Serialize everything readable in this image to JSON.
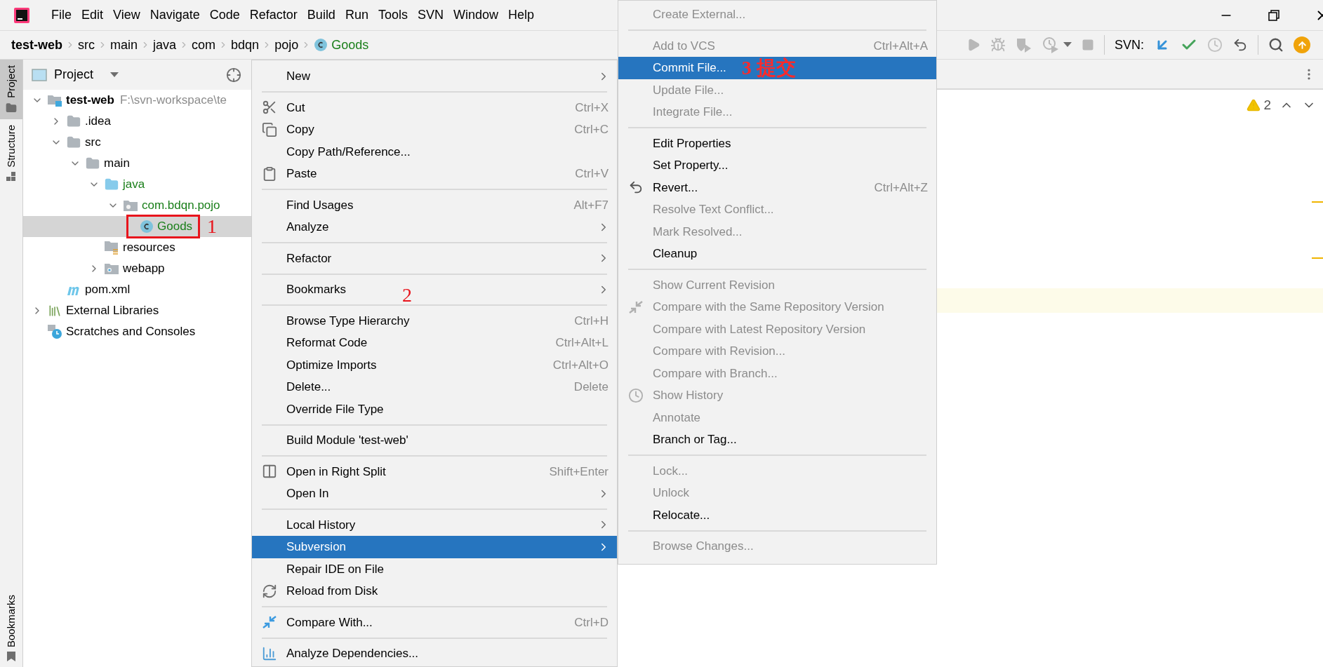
{
  "menu_bar": {
    "items": [
      "File",
      "Edit",
      "View",
      "Navigate",
      "Code",
      "Refactor",
      "Build",
      "Run",
      "Tools",
      "SVN",
      "Window",
      "Help"
    ]
  },
  "breadcrumbs": [
    {
      "label": "test-web",
      "kind": "project",
      "added": false
    },
    {
      "label": "src",
      "kind": "folder",
      "added": false
    },
    {
      "label": "main",
      "kind": "folder",
      "added": false
    },
    {
      "label": "java",
      "kind": "folder",
      "added": false
    },
    {
      "label": "com",
      "kind": "folder",
      "added": false
    },
    {
      "label": "bdqn",
      "kind": "folder",
      "added": false
    },
    {
      "label": "pojo",
      "kind": "folder",
      "added": false
    },
    {
      "label": "Goods",
      "kind": "class",
      "added": true
    }
  ],
  "toolbar": {
    "svn_label": "SVN:"
  },
  "tool_stripe": {
    "top": [
      {
        "label": "Project",
        "selected": true
      },
      {
        "label": "Structure",
        "selected": false
      }
    ],
    "bottom": [
      {
        "label": "Bookmarks",
        "selected": false
      }
    ]
  },
  "project_panel": {
    "title": "Project",
    "tree": [
      {
        "label": "test-web",
        "hint": "F:\\svn-workspace\\te",
        "kind": "module",
        "added": false,
        "selected": false,
        "expanded": true,
        "children": [
          {
            "label": ".idea",
            "kind": "folder",
            "added": false,
            "selected": false,
            "expanded": false
          },
          {
            "label": "src",
            "kind": "folder",
            "added": false,
            "selected": false,
            "expanded": true,
            "children": [
              {
                "label": "main",
                "kind": "folder",
                "added": false,
                "selected": false,
                "expanded": true,
                "children": [
                  {
                    "label": "java",
                    "kind": "source-folder",
                    "added": true,
                    "selected": false,
                    "expanded": true,
                    "children": [
                      {
                        "label": "com.bdqn.pojo",
                        "kind": "package",
                        "added": true,
                        "selected": false,
                        "expanded": true,
                        "children": [
                          {
                            "label": "Goods",
                            "kind": "class",
                            "added": true,
                            "selected": true,
                            "annotation": "1"
                          }
                        ]
                      }
                    ]
                  },
                  {
                    "label": "resources",
                    "kind": "resources-folder",
                    "added": false,
                    "selected": false
                  },
                  {
                    "label": "webapp",
                    "kind": "web-folder",
                    "added": false,
                    "selected": false,
                    "expanded": false
                  }
                ]
              }
            ]
          },
          {
            "label": "pom.xml",
            "kind": "maven-file",
            "added": false,
            "selected": false
          }
        ]
      },
      {
        "label": "External Libraries",
        "kind": "libraries",
        "added": false,
        "selected": false,
        "expanded": false
      },
      {
        "label": "Scratches and Consoles",
        "kind": "scratches",
        "added": false,
        "selected": false
      }
    ]
  },
  "context_menu": {
    "sections": [
      [
        {
          "label": "New",
          "submenu": true,
          "selected": false
        }
      ],
      [
        {
          "label": "Cut",
          "shortcut": "Ctrl+X",
          "submenu": false,
          "selected": false
        },
        {
          "label": "Copy",
          "shortcut": "Ctrl+C",
          "submenu": false,
          "selected": false
        },
        {
          "label": "Copy Path/Reference...",
          "submenu": false,
          "selected": false
        },
        {
          "label": "Paste",
          "shortcut": "Ctrl+V",
          "submenu": false,
          "selected": false
        }
      ],
      [
        {
          "label": "Find Usages",
          "shortcut": "Alt+F7",
          "submenu": false,
          "selected": false
        },
        {
          "label": "Analyze",
          "submenu": true,
          "selected": false
        }
      ],
      [
        {
          "label": "Refactor",
          "submenu": true,
          "selected": false
        }
      ],
      [
        {
          "label": "Bookmarks",
          "submenu": true,
          "selected": false,
          "annotation": "2"
        }
      ],
      [
        {
          "label": "Browse Type Hierarchy",
          "shortcut": "Ctrl+H",
          "submenu": false,
          "selected": false
        },
        {
          "label": "Reformat Code",
          "shortcut": "Ctrl+Alt+L",
          "submenu": false,
          "selected": false
        },
        {
          "label": "Optimize Imports",
          "shortcut": "Ctrl+Alt+O",
          "submenu": false,
          "selected": false
        },
        {
          "label": "Delete...",
          "shortcut": "Delete",
          "submenu": false,
          "selected": false
        },
        {
          "label": "Override File Type",
          "submenu": false,
          "selected": false
        }
      ],
      [
        {
          "label": "Build Module 'test-web'",
          "submenu": false,
          "selected": false
        }
      ],
      [
        {
          "label": "Open in Right Split",
          "shortcut": "Shift+Enter",
          "submenu": false,
          "selected": false
        },
        {
          "label": "Open In",
          "submenu": true,
          "selected": false
        }
      ],
      [
        {
          "label": "Local History",
          "submenu": true,
          "selected": false
        },
        {
          "label": "Subversion",
          "submenu": true,
          "selected": true
        },
        {
          "label": "Repair IDE on File",
          "submenu": false,
          "selected": false
        },
        {
          "label": "Reload from Disk",
          "submenu": false,
          "selected": false
        }
      ],
      [
        {
          "label": "Compare With...",
          "shortcut": "Ctrl+D",
          "submenu": false,
          "selected": false
        }
      ],
      [
        {
          "label": "Analyze Dependencies...",
          "submenu": false,
          "selected": false
        }
      ]
    ]
  },
  "subversion_menu": {
    "sections": [
      [
        {
          "label": "Create External...",
          "disabled": true,
          "selected": false
        }
      ],
      [
        {
          "label": "Add to VCS",
          "shortcut": "Ctrl+Alt+A",
          "disabled": true,
          "selected": false
        },
        {
          "label": "Commit File...",
          "disabled": false,
          "selected": true,
          "annotation": "3 提交"
        },
        {
          "label": "Update File...",
          "disabled": true,
          "selected": false
        },
        {
          "label": "Integrate File...",
          "disabled": true,
          "selected": false
        }
      ],
      [
        {
          "label": "Edit Properties",
          "disabled": false,
          "selected": false
        },
        {
          "label": "Set Property...",
          "disabled": false,
          "selected": false
        },
        {
          "label": "Revert...",
          "shortcut": "Ctrl+Alt+Z",
          "disabled": false,
          "selected": false
        },
        {
          "label": "Resolve Text Conflict...",
          "disabled": true,
          "selected": false
        },
        {
          "label": "Mark Resolved...",
          "disabled": true,
          "selected": false
        },
        {
          "label": "Cleanup",
          "disabled": false,
          "selected": false
        }
      ],
      [
        {
          "label": "Show Current Revision",
          "disabled": true,
          "selected": false
        },
        {
          "label": "Compare with the Same Repository Version",
          "disabled": true,
          "selected": false
        },
        {
          "label": "Compare with Latest Repository Version",
          "disabled": true,
          "selected": false
        },
        {
          "label": "Compare with Revision...",
          "disabled": true,
          "selected": false
        },
        {
          "label": "Compare with Branch...",
          "disabled": true,
          "selected": false
        },
        {
          "label": "Show History",
          "disabled": true,
          "selected": false
        },
        {
          "label": "Annotate",
          "disabled": true,
          "selected": false
        },
        {
          "label": "Branch or Tag...",
          "disabled": false,
          "selected": false
        }
      ],
      [
        {
          "label": "Lock...",
          "disabled": true,
          "selected": false
        },
        {
          "label": "Unlock",
          "disabled": true,
          "selected": false
        },
        {
          "label": "Relocate...",
          "disabled": false,
          "selected": false
        }
      ],
      [
        {
          "label": "Browse Changes...",
          "disabled": true,
          "selected": false
        }
      ]
    ]
  },
  "editor": {
    "warning_count": "2"
  }
}
